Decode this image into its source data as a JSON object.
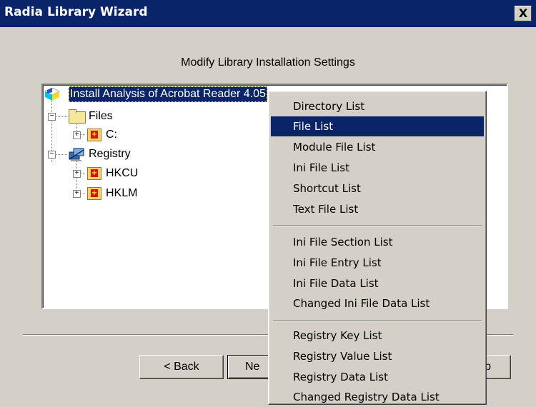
{
  "window": {
    "title": "Radia Library Wizard",
    "close_glyph": "X"
  },
  "heading": "Modify Library Installation Settings",
  "tree": {
    "root_label": "Install Analysis of Acrobat Reader 4.05",
    "files_label": "Files",
    "drive_label": "C:",
    "registry_label": "Registry",
    "hkcu_label": "HKCU",
    "hklm_label": "HKLM",
    "icons": [
      "root-cube-icon",
      "folder-icon",
      "red-plus-icon",
      "registry-icon"
    ]
  },
  "buttons": {
    "back": "< Back",
    "next": "Ne",
    "help": "elp"
  },
  "context_menu": {
    "selected": "File List",
    "items": [
      "Directory List",
      "File List",
      "Module File List",
      "Ini File List",
      "Shortcut List",
      "Text File List",
      "Ini File Section List",
      "Ini File Entry List",
      "Ini File Data List",
      "Changed Ini File Data List",
      "Registry Key List",
      "Registry Value List",
      "Registry Data List",
      "Changed Registry Data List"
    ]
  },
  "colors": {
    "titlebar": "#0a246a",
    "face": "#d4d0c8",
    "selection": "#0a246a"
  }
}
